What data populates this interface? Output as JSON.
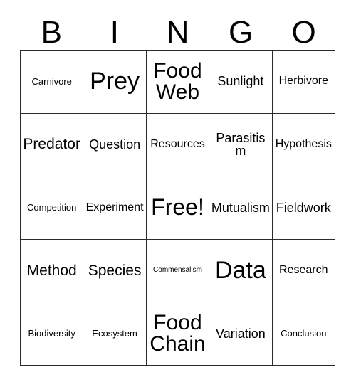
{
  "card": {
    "header_letters": [
      "B",
      "I",
      "N",
      "G",
      "O"
    ],
    "colors": {
      "background": "#ffffff",
      "border": "#2b2b2b",
      "text": "#000000"
    },
    "grid": {
      "columns": 5,
      "rows": 5,
      "cells": [
        [
          {
            "label": "Carnivore",
            "size": "fs-xxs"
          },
          {
            "label": "Prey",
            "size": "fs-xxl"
          },
          {
            "label": "Food Web",
            "size": "fs-lg"
          },
          {
            "label": "Sunlight",
            "size": "fs-sm"
          },
          {
            "label": "Herbivore",
            "size": "fs-xs"
          }
        ],
        [
          {
            "label": "Predator",
            "size": "fs-md"
          },
          {
            "label": "Question",
            "size": "fs-sm"
          },
          {
            "label": "Resources",
            "size": "fs-xs"
          },
          {
            "label": "Parasitism",
            "size": "fs-sm"
          },
          {
            "label": "Hypothesis",
            "size": "fs-xs"
          }
        ],
        [
          {
            "label": "Competition",
            "size": "fs-xxs"
          },
          {
            "label": "Experiment",
            "size": "fs-xs"
          },
          {
            "label": "Free!",
            "size": "fs-xl"
          },
          {
            "label": "Mutualism",
            "size": "fs-sm"
          },
          {
            "label": "Fieldwork",
            "size": "fs-sm"
          }
        ],
        [
          {
            "label": "Method",
            "size": "fs-md"
          },
          {
            "label": "Species",
            "size": "fs-md"
          },
          {
            "label": "Commensalism",
            "size": "fs-tiny"
          },
          {
            "label": "Data",
            "size": "fs-xxl"
          },
          {
            "label": "Research",
            "size": "fs-xs"
          }
        ],
        [
          {
            "label": "Biodiversity",
            "size": "fs-xxs"
          },
          {
            "label": "Ecosystem",
            "size": "fs-xxs"
          },
          {
            "label": "Food Chain",
            "size": "fs-lg"
          },
          {
            "label": "Variation",
            "size": "fs-sm"
          },
          {
            "label": "Conclusion",
            "size": "fs-xxs"
          }
        ]
      ]
    }
  }
}
